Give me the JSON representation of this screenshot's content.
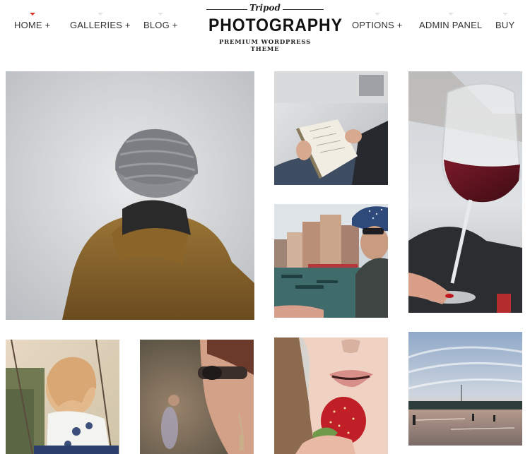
{
  "nav": {
    "home": "HOME +",
    "galleries": "GALLERIES +",
    "blog": "BLOG +",
    "options": "OPTIONS +",
    "admin": "ADMIN PANEL",
    "buy": "BUY"
  },
  "logo": {
    "script": "Tripod",
    "title": "PHOTOGRAPHY",
    "subtitle": "PREMIUM WORDPRESS THEME"
  },
  "colors": {
    "accent": "#d9352b",
    "inactive_marker": "#e6e6e6"
  },
  "gallery": {
    "photos": [
      "person-knit-hat-photo",
      "reading-book-photo",
      "red-wine-glass-photo",
      "venice-canal-photo",
      "child-swing-photo",
      "sunglasses-woman-photo",
      "strawberry-lips-photo",
      "sunset-beach-photo"
    ]
  }
}
